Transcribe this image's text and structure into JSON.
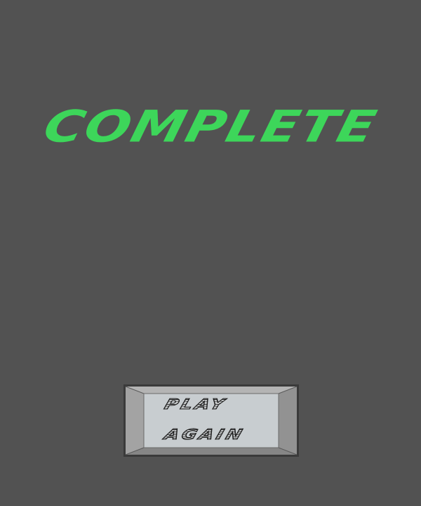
{
  "screen": {
    "background": "#525252"
  },
  "title": {
    "text": "COMPLETE",
    "color": "#3dd65a"
  },
  "play_again_button": {
    "line1": "PLAY",
    "line2": "AGAIN",
    "face_color": "#c8cdd0",
    "frame_color": "#9a9a9a",
    "border_color": "#3a3a3a"
  }
}
